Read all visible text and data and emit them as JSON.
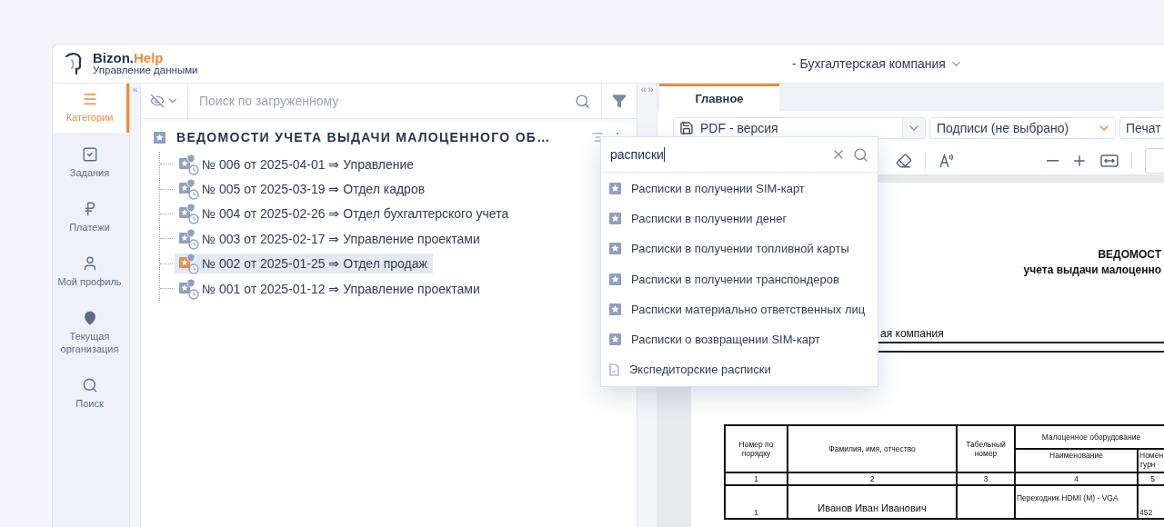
{
  "app": {
    "brand": "Bizon.",
    "brand_accent": "Help",
    "subtitle": "Управление данными"
  },
  "organization": {
    "label": "- Бухгалтерская компания"
  },
  "sidebar": {
    "collapse": "«",
    "items": [
      {
        "label": "Категории",
        "kind": "menu",
        "selected": true
      },
      {
        "label": "Задания",
        "kind": "tasks",
        "selected": false
      },
      {
        "label": "Платежи",
        "kind": "ruble",
        "selected": false
      },
      {
        "label": "Мой профиль",
        "kind": "user",
        "selected": false
      },
      {
        "label": "Текущая организация",
        "kind": "pin",
        "selected": false
      },
      {
        "label": "Поиск",
        "kind": "search",
        "selected": false
      }
    ]
  },
  "left_panel": {
    "search": {
      "placeholder": "Поиск по загруженному"
    },
    "tree": {
      "title": "ВЕДОМОСТИ УЧЕТА ВЫДАЧИ МАЛОЦЕННОГО ОБ…",
      "items": [
        {
          "label": "№ 006 от 2025-04-01 ⇒ Управление",
          "selected": false
        },
        {
          "label": "№ 005 от 2025-03-19 ⇒ Отдел кадров",
          "selected": false
        },
        {
          "label": "№ 004 от 2025-02-26 ⇒ Отдел бухгалтерского учета",
          "selected": false
        },
        {
          "label": "№ 003 от 2025-02-17 ⇒ Управление проектами",
          "selected": false
        },
        {
          "label": "№ 002 от 2025-01-25 ⇒ Отдел продаж",
          "selected": true
        },
        {
          "label": "№ 001 от 2025-01-12 ⇒ Управление проектами",
          "selected": false
        }
      ]
    }
  },
  "splitter": {
    "left": "«",
    "right": "»"
  },
  "right_panel": {
    "tabs": [
      {
        "label": "Главное",
        "selected": true
      }
    ],
    "format_select": {
      "value": "PDF - версия"
    },
    "signature_select": {
      "value": "Подписи (не выбрано)"
    },
    "print_button": {
      "label": "Печат"
    },
    "document": {
      "title": "ВЕДОМОСТ",
      "subtitle": "учета выдачи малоценно",
      "organization": "ая компания",
      "table": {
        "columns": [
          {
            "label": "Номер по порядку"
          },
          {
            "label": "Фамилия, имя, отчество"
          },
          {
            "label": "Табельный номер"
          },
          {
            "label": "Малоценное оборудование",
            "children": [
              {
                "label": "Наименование"
              },
              {
                "label": "Номен турн"
              }
            ]
          }
        ],
        "column_numbers": [
          "1",
          "2",
          "3",
          "4",
          "5"
        ],
        "rows": [
          {
            "number": "1",
            "name": "Иванов Иван Иванович",
            "equipment": "Переходник HDMI (M) - VGA",
            "column_5": "452"
          }
        ]
      }
    }
  },
  "search_popup": {
    "value": "расписки",
    "results": [
      {
        "label": "Расписки в получении SIM-карт",
        "kind": "template"
      },
      {
        "label": "Расписки в получении денег",
        "kind": "template"
      },
      {
        "label": "Расписки в получении топливной карты",
        "kind": "template"
      },
      {
        "label": "Расписки в получении транспондеров",
        "kind": "template"
      },
      {
        "label": "Расписки материально ответственных лиц",
        "kind": "template"
      },
      {
        "label": "Расписки о возвращении SIM-карт",
        "kind": "template"
      },
      {
        "label": "Экспедиторские расписки",
        "kind": "document"
      }
    ]
  }
}
